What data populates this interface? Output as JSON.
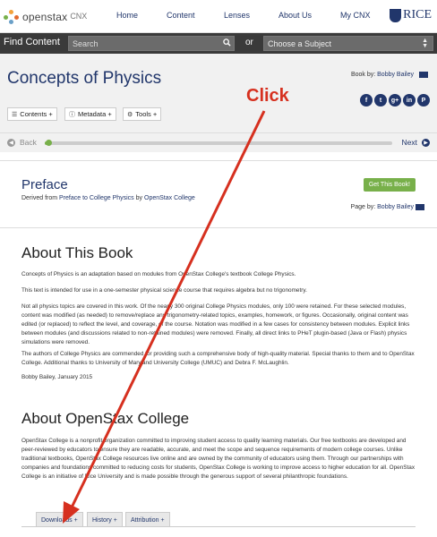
{
  "topnav": {
    "logo_brand": "openstax",
    "logo_sub": "CNX",
    "links": [
      "Home",
      "Content",
      "Lenses",
      "About Us",
      "My CNX"
    ],
    "partner": "RICE"
  },
  "findbar": {
    "label": "Find Content",
    "search_placeholder": "Search",
    "or": "or",
    "subject": "Choose a Subject"
  },
  "book": {
    "title": "Concepts of Physics",
    "by_label": "Book by:",
    "author": "Bobby Bailey",
    "social": [
      "f",
      "t",
      "g+",
      "in",
      "P"
    ],
    "tools": [
      "Contents +",
      "Metadata +",
      "Tools +"
    ],
    "back": "Back",
    "next": "Next",
    "progress": 0.01
  },
  "page": {
    "title": "Preface",
    "derived_prefix": "Derived from",
    "derived_link": "Preface to College Physics",
    "derived_by": "by",
    "derived_org": "OpenStax College",
    "get_book": "Get This Book!",
    "by_label": "Page by:",
    "author": "Bobby Bailey"
  },
  "content": {
    "h_about_book": "About This Book",
    "p1": "Concepts of Physics is an adaptation based on modules from OpenStax College's textbook College Physics.",
    "p2": "This text is intended for use in a one-semester physical science course that requires algebra but no trigonometry.",
    "p3": "Not all physics topics are covered in this work. Of the nearly 300 original College Physics modules, only 100 were retained. For these selected modules, content was modified (as needed) to remove/replace any trigonometry-related topics, examples, homework, or figures. Occasionally, original content was edited (or replaced) to reflect the level, and coverage, of the course. Notation was modified in a few cases for consistency between modules. Explicit links between modules (and discussions related to non-retained modules) were removed. Finally, all direct links to PHeT plugin-based (Java or Flash) physics simulations were removed.",
    "p4": "The authors of College Physics are commended for providing such a comprehensive body of high-quality material. Special thanks to them and to OpenStax College. Additional thanks to University of Maryland University College (UMUC) and Debra F. McLaughlin.",
    "p5": "Bobby Bailey, January 2015",
    "h_about_osc": "About OpenStax College",
    "p6": "OpenStax College is a nonprofit organization committed to improving student access to quality learning materials. Our free textbooks are developed and peer-reviewed by educators to ensure they are readable, accurate, and meet the scope and sequence requirements of modern college courses. Unlike traditional textbooks, OpenStax College resources live online and are owned by the community of educators using them. Through our partnerships with companies and foundations committed to reducing costs for students, OpenStax College is working to improve access to higher education for all. OpenStax College is an initiative of Rice University and is made possible through the generous support of several philanthropic foundations."
  },
  "bottom_tabs": [
    "Downloads +",
    "History +",
    "Attribution +"
  ],
  "annotation": {
    "label": "Click"
  },
  "colors": {
    "navy": "#21366b",
    "green": "#78b04a",
    "red": "#d6301f"
  }
}
